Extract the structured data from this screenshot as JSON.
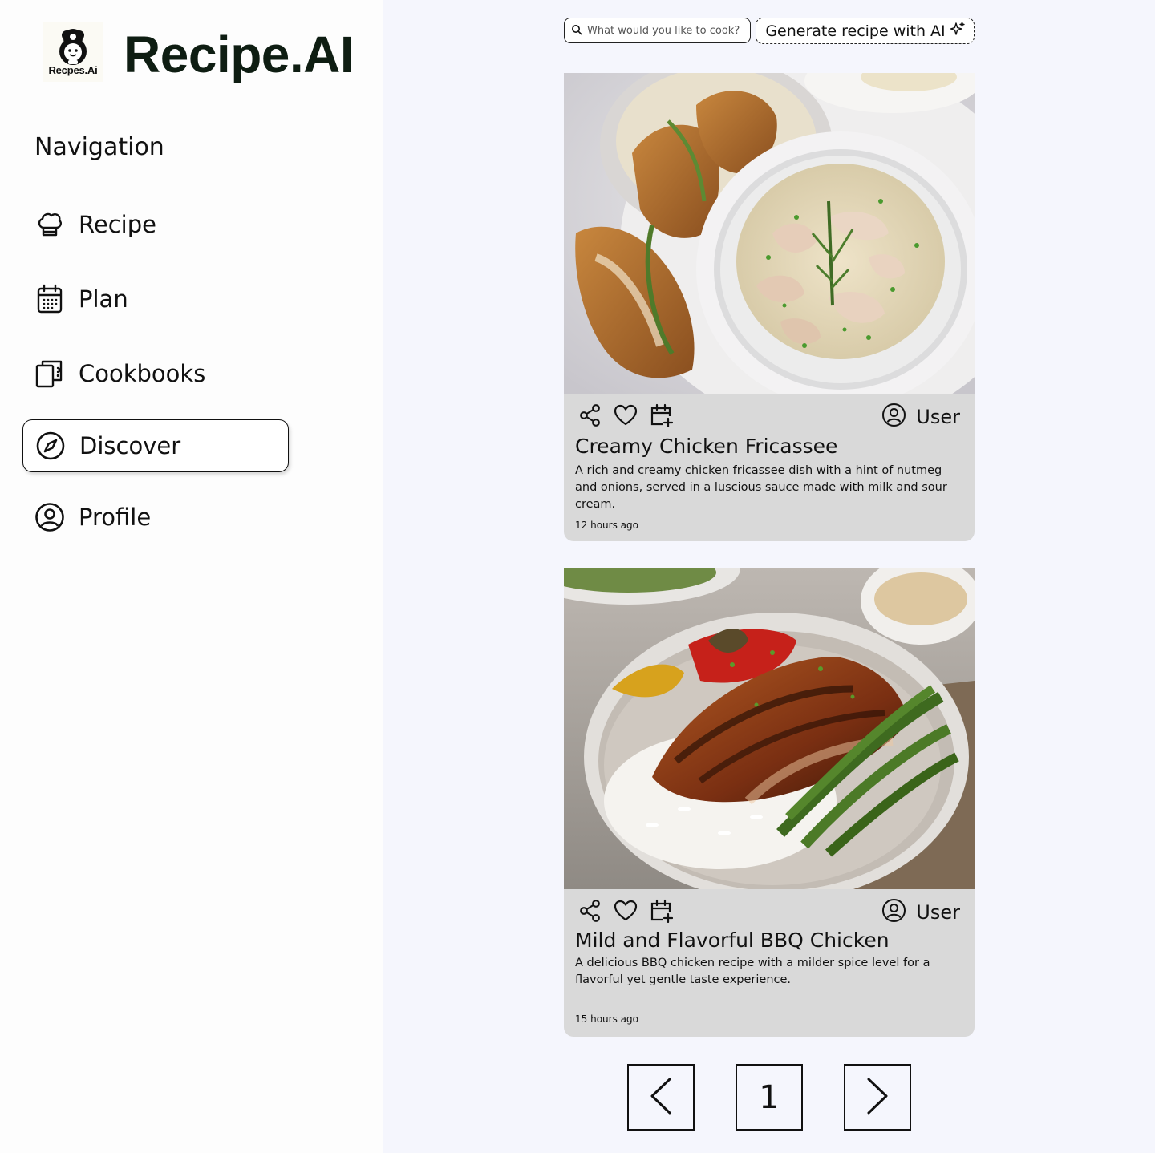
{
  "brand": {
    "logo_text": "Recpes.Ai",
    "title": "Recipe.AI"
  },
  "nav": {
    "heading": "Navigation",
    "items": [
      {
        "label": "Recipe",
        "icon": "chef-hat-icon"
      },
      {
        "label": "Plan",
        "icon": "calendar-icon"
      },
      {
        "label": "Cookbooks",
        "icon": "cookbook-icon"
      },
      {
        "label": "Discover",
        "icon": "compass-icon",
        "active": true
      },
      {
        "label": "Profile",
        "icon": "user-circle-icon"
      }
    ]
  },
  "search": {
    "placeholder": "What would you like to cook?"
  },
  "generate_button": {
    "label": "Generate recipe with AI"
  },
  "recipes": [
    {
      "title": "Creamy Chicken Fricassee",
      "description": "A rich and creamy chicken fricassee dish with a hint of nutmeg and onions, served in a luscious sauce made with milk and sour cream.",
      "time": "12 hours ago",
      "user": "User"
    },
    {
      "title": "Mild and Flavorful BBQ Chicken",
      "description": "A delicious BBQ chicken recipe with a milder spice level for a flavorful yet gentle taste experience.",
      "time": "15 hours ago",
      "user": "User"
    }
  ],
  "pagination": {
    "current_page": "1"
  },
  "colors": {
    "sidebar_bg": "#fdfdfd",
    "main_bg": "#f5f6fd",
    "card_bg": "#d9d9d9",
    "brand_title": "#0e1d12"
  }
}
